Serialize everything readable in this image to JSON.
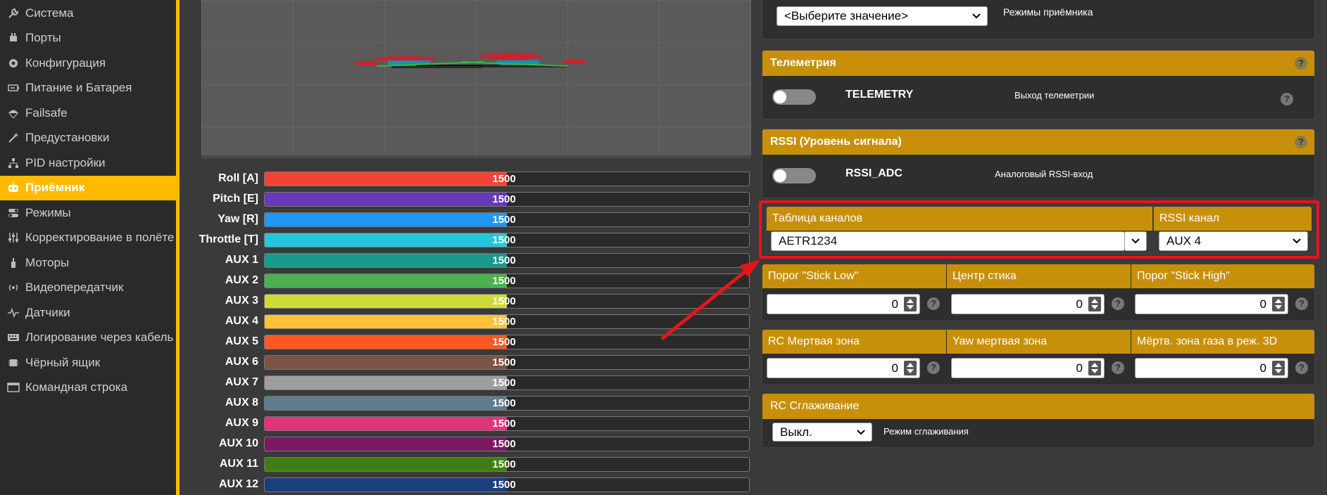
{
  "sidebar": {
    "items": [
      {
        "label": "Система",
        "icon": "wrench-icon"
      },
      {
        "label": "Порты",
        "icon": "plug-icon"
      },
      {
        "label": "Конфигурация",
        "icon": "gear-icon"
      },
      {
        "label": "Питание и Батарея",
        "icon": "battery-icon"
      },
      {
        "label": "Failsafe",
        "icon": "parachute-icon"
      },
      {
        "label": "Предустановки",
        "icon": "magic-wand-icon"
      },
      {
        "label": "PID настройки",
        "icon": "sitemap-icon"
      },
      {
        "label": "Приёмник",
        "icon": "robot-icon"
      },
      {
        "label": "Режимы",
        "icon": "toggle-icon"
      },
      {
        "label": "Корректирование в полёте",
        "icon": "sliders-icon"
      },
      {
        "label": "Моторы",
        "icon": "motor-icon"
      },
      {
        "label": "Видеопередатчик",
        "icon": "broadcast-icon"
      },
      {
        "label": "Датчики",
        "icon": "pulse-icon"
      },
      {
        "label": "Логирование через кабель",
        "icon": "keyboard-icon"
      },
      {
        "label": "Чёрный ящик",
        "icon": "chip-icon"
      },
      {
        "label": "Командная строка",
        "icon": "terminal-icon"
      }
    ],
    "active_index": 7
  },
  "channels": [
    {
      "label": "Roll [A]",
      "value": "1500",
      "color": "#f44336"
    },
    {
      "label": "Pitch [E]",
      "value": "1500",
      "color": "#673ab7"
    },
    {
      "label": "Yaw [R]",
      "value": "1500",
      "color": "#2196f3"
    },
    {
      "label": "Throttle [T]",
      "value": "1500",
      "color": "#26c6da"
    },
    {
      "label": "AUX 1",
      "value": "1500",
      "color": "#1b9a8c"
    },
    {
      "label": "AUX 2",
      "value": "1500",
      "color": "#4caf50"
    },
    {
      "label": "AUX 3",
      "value": "1500",
      "color": "#cddc39"
    },
    {
      "label": "AUX 4",
      "value": "1500",
      "color": "#ffc13a"
    },
    {
      "label": "AUX 5",
      "value": "1500",
      "color": "#ff5722"
    },
    {
      "label": "AUX 6",
      "value": "1500",
      "color": "#7b5444"
    },
    {
      "label": "AUX 7",
      "value": "1500",
      "color": "#9e9e9e"
    },
    {
      "label": "AUX 8",
      "value": "1500",
      "color": "#607d8b"
    },
    {
      "label": "AUX 9",
      "value": "1500",
      "color": "#e2337a"
    },
    {
      "label": "AUX 10",
      "value": "1500",
      "color": "#7b1a62"
    },
    {
      "label": "AUX 11",
      "value": "1500",
      "color": "#3f7f12"
    },
    {
      "label": "AUX 12",
      "value": "1500",
      "color": "#1a3f80"
    }
  ],
  "channel_fill_fraction": 0.5,
  "receiver_mode": {
    "select_value": "<Выберите значение>",
    "label": "Режимы приёмника"
  },
  "telemetry": {
    "title": "Телеметрия",
    "name": "TELEMETRY",
    "description": "Выход телеметрии",
    "help": "?"
  },
  "rssi": {
    "title": "RSSI (Уровень сигнала)",
    "name": "RSSI_ADC",
    "description": "Аналоговый RSSI-вход",
    "help": "?"
  },
  "channel_map": {
    "title": "Таблица каналов",
    "value": "AETR1234",
    "rssi_title": "RSSI канал",
    "rssi_value": "AUX 4"
  },
  "stick": {
    "low_title": "Порог \"Stick Low\"",
    "low_value": "0",
    "center_title": "Центр стика",
    "center_value": "0",
    "high_title": "Порог \"Stick High\"",
    "high_value": "0"
  },
  "deadband": {
    "rc_title": "RC Мертвая зона",
    "rc_value": "0",
    "yaw_title": "Yaw мертвая зона",
    "yaw_value": "0",
    "d3_title": "Мёртв. зона газа в реж. 3D",
    "d3_value": "0"
  },
  "smoothing": {
    "title": "RC Сглаживание",
    "select_value": "Выкл.",
    "label": "Режим сглаживания"
  },
  "help_mark": "?",
  "highlight_color": "#e5151d"
}
